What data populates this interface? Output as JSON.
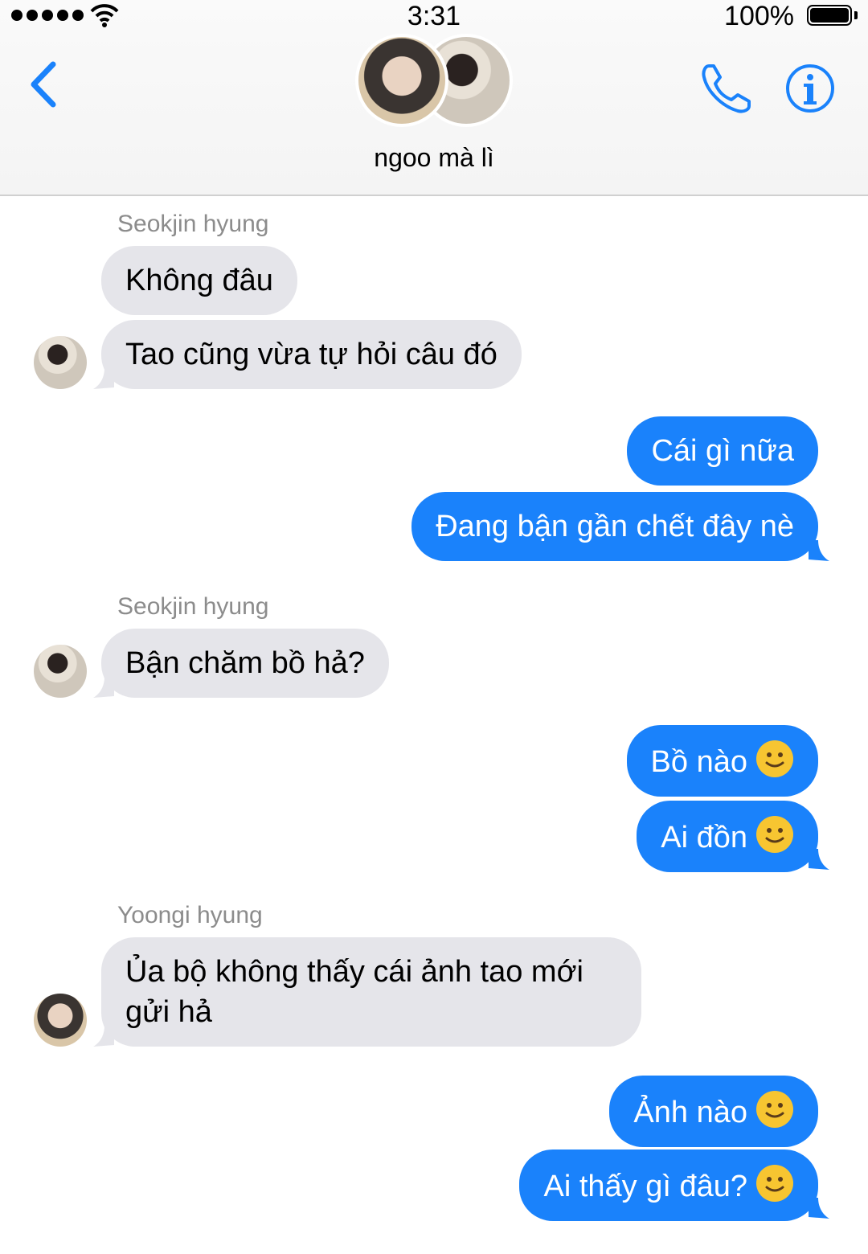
{
  "status_bar": {
    "time": "3:31",
    "battery": "100%"
  },
  "header": {
    "group_name": "ngoo mà lì",
    "back_icon": "chevron-left-icon",
    "call_icon": "phone-icon",
    "info_icon": "info-icon"
  },
  "colors": {
    "accent": "#1a82fb",
    "incoming_bubble": "#e5e5ea",
    "sender_label": "#8c8c8c"
  },
  "messages": [
    {
      "sender": "Seokjin hyung"
    },
    {
      "text": "Không đâu"
    },
    {
      "text": "Tao cũng vừa tự hỏi câu đó"
    },
    {
      "text": "Cái gì nữa"
    },
    {
      "text": "Đang bận gần chết đây nè"
    },
    {
      "sender": "Seokjin hyung"
    },
    {
      "text": "Bận chăm bồ hả?"
    },
    {
      "text": "Bồ nào"
    },
    {
      "text": "Ai đồn"
    },
    {
      "sender": "Yoongi hyung"
    },
    {
      "text": "Ủa bộ không thấy cái ảnh tao mới gửi hả"
    },
    {
      "text": "Ảnh nào"
    },
    {
      "text": "Ai thấy gì đâu?"
    }
  ]
}
